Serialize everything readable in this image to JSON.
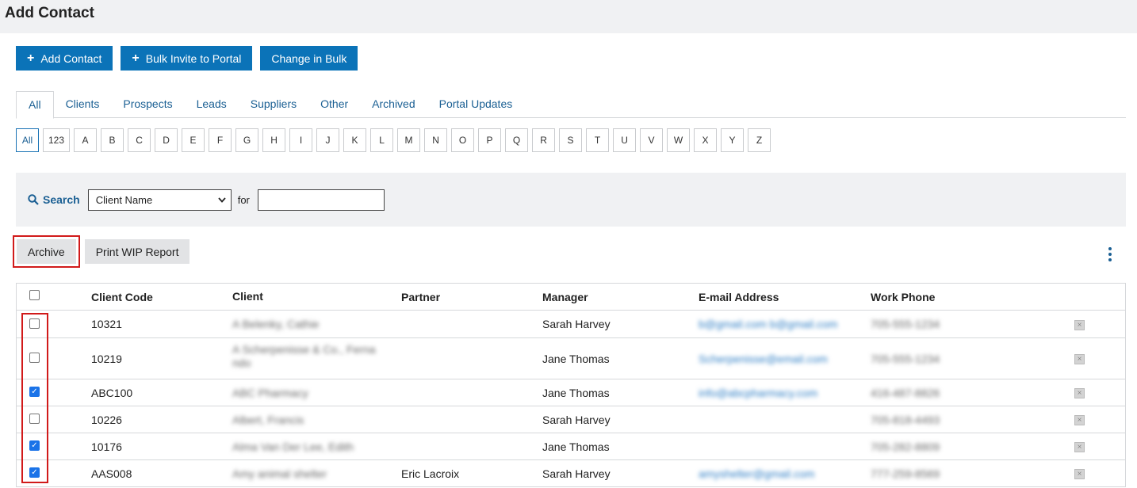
{
  "page": {
    "title": "Add Contact"
  },
  "toolbar": {
    "add_contact": "Add Contact",
    "bulk_invite": "Bulk Invite to Portal",
    "change_bulk": "Change in Bulk"
  },
  "tabs": [
    "All",
    "Clients",
    "Prospects",
    "Leads",
    "Suppliers",
    "Other",
    "Archived",
    "Portal Updates"
  ],
  "active_tab": "All",
  "letters": [
    "All",
    "123",
    "A",
    "B",
    "C",
    "D",
    "E",
    "F",
    "G",
    "H",
    "I",
    "J",
    "K",
    "L",
    "M",
    "N",
    "O",
    "P",
    "Q",
    "R",
    "S",
    "T",
    "U",
    "V",
    "W",
    "X",
    "Y",
    "Z"
  ],
  "active_letter": "All",
  "search": {
    "label": "Search",
    "field_selected": "Client Name",
    "for_label": "for",
    "value": ""
  },
  "actions": {
    "archive": "Archive",
    "print_wip": "Print WIP Report"
  },
  "table": {
    "headers": {
      "code": "Client Code",
      "client": "Client",
      "partner": "Partner",
      "manager": "Manager",
      "email": "E-mail Address",
      "phone": "Work Phone"
    },
    "rows": [
      {
        "checked": false,
        "code": "10321",
        "client": "A Belenky, Cathie",
        "partner": "",
        "manager": "Sarah Harvey",
        "email": "b@gmail.com b@gmail.com",
        "phone": "705-555-1234"
      },
      {
        "checked": false,
        "code": "10219",
        "client": "A Scherpenisse & Co., Ferna ndo",
        "partner": "",
        "manager": "Jane Thomas",
        "email": "Scherpenisse@email.com",
        "phone": "705-555-1234"
      },
      {
        "checked": true,
        "code": "ABC100",
        "client": "ABC Pharmacy",
        "partner": "",
        "manager": "Jane Thomas",
        "email": "info@abcpharmacy.com",
        "phone": "416-487-8826"
      },
      {
        "checked": false,
        "code": "10226",
        "client": "Albert, Francis",
        "partner": "",
        "manager": "Sarah Harvey",
        "email": "",
        "phone": "705-818-4493"
      },
      {
        "checked": true,
        "code": "10176",
        "client": "Alma Van Der Lee, Edith",
        "partner": "",
        "manager": "Jane Thomas",
        "email": "",
        "phone": "705-282-8809"
      },
      {
        "checked": true,
        "code": "AAS008",
        "client": "Amy animal shelter",
        "partner": "Eric Lacroix",
        "manager": "Sarah Harvey",
        "email": "amyshelter@gmail.com",
        "phone": "777-259-8569"
      }
    ]
  },
  "icons": {
    "plus": "plus-icon",
    "search": "search-icon",
    "more": "more-vertical-icon",
    "delete": "delete-icon"
  },
  "colors": {
    "primary": "#0b73b8",
    "link": "#1a5f93",
    "highlight": "#d11a1a"
  }
}
